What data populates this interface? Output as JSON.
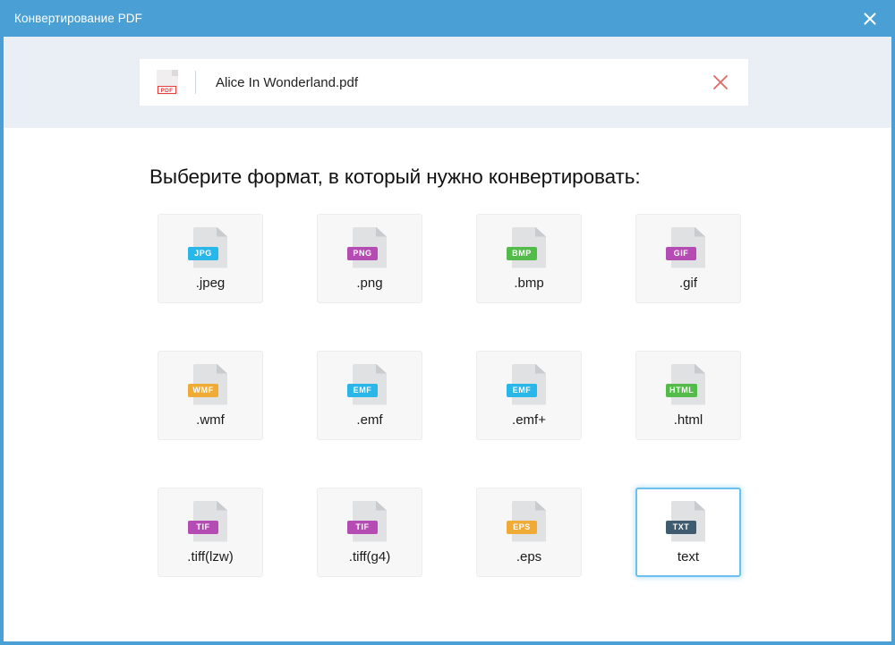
{
  "window": {
    "title": "Конвертирование PDF",
    "close_icon": "close-icon",
    "accent_color": "#4a9fd5"
  },
  "file_row": {
    "icon": "pdf-file-icon",
    "icon_glyph": "PDF",
    "name": "Alice In Wonderland.pdf",
    "remove_icon": "close-icon",
    "remove_color": "#e06a6a"
  },
  "main": {
    "heading": "Выберите формат, в который нужно конвертировать:",
    "formats": [
      {
        "label": ".jpeg",
        "badge": "JPG",
        "badge_color": "#29b6e8",
        "selected": false,
        "icon": "file-jpg-icon"
      },
      {
        "label": ".png",
        "badge": "PNG",
        "badge_color": "#b44cb4",
        "selected": false,
        "icon": "file-png-icon"
      },
      {
        "label": ".bmp",
        "badge": "BMP",
        "badge_color": "#52bb4a",
        "selected": false,
        "icon": "file-bmp-icon"
      },
      {
        "label": ".gif",
        "badge": "GIF",
        "badge_color": "#b44cb4",
        "selected": false,
        "icon": "file-gif-icon"
      },
      {
        "label": ".wmf",
        "badge": "WMF",
        "badge_color": "#f0ab36",
        "selected": false,
        "icon": "file-wmf-icon"
      },
      {
        "label": ".emf",
        "badge": "EMF",
        "badge_color": "#29b6e8",
        "selected": false,
        "icon": "file-emf-icon"
      },
      {
        "label": ".emf+",
        "badge": "EMF",
        "badge_color": "#29b6e8",
        "selected": false,
        "icon": "file-emfplus-icon"
      },
      {
        "label": ".html",
        "badge": "HTML",
        "badge_color": "#52bb4a",
        "selected": false,
        "icon": "file-html-icon"
      },
      {
        "label": ".tiff(lzw)",
        "badge": "TIF",
        "badge_color": "#b44cb4",
        "selected": false,
        "icon": "file-tiff-lzw-icon"
      },
      {
        "label": ".tiff(g4)",
        "badge": "TIF",
        "badge_color": "#b44cb4",
        "selected": false,
        "icon": "file-tiff-g4-icon"
      },
      {
        "label": ".eps",
        "badge": "EPS",
        "badge_color": "#f0ab36",
        "selected": false,
        "icon": "file-eps-icon"
      },
      {
        "label": "text",
        "badge": "TXT",
        "badge_color": "#3f5b70",
        "selected": true,
        "icon": "file-txt-icon"
      }
    ]
  }
}
